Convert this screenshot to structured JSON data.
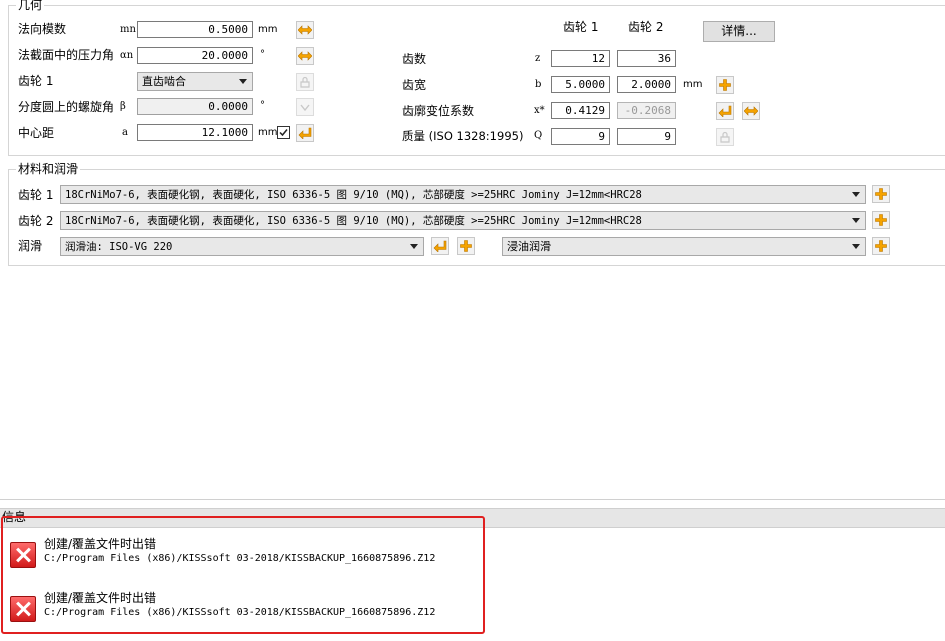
{
  "geometry": {
    "title": "几何",
    "normal_module": {
      "label": "法向模数",
      "symbol": "mn",
      "value": "0.5000",
      "unit": "mm"
    },
    "pressure_angle": {
      "label": "法截面中的压力角",
      "symbol": "αn",
      "value": "20.0000",
      "unit": "°"
    },
    "gear1": {
      "label": "齿轮 1",
      "type_value": "直齿啮合"
    },
    "helix_angle": {
      "label": "分度圆上的螺旋角",
      "symbol": "β",
      "value": "0.0000",
      "unit": "°"
    },
    "center_distance": {
      "label": "中心距",
      "symbol": "a",
      "value": "12.1000",
      "unit": "mm",
      "checkbox_checked": true
    },
    "col_gear1": "齿轮 1",
    "col_gear2": "齿轮 2",
    "details_button": "详情...",
    "teeth": {
      "label": "齿数",
      "symbol": "z",
      "gear1": "12",
      "gear2": "36"
    },
    "face_width": {
      "label": "齿宽",
      "symbol": "b",
      "gear1": "5.0000",
      "gear2": "2.0000",
      "unit": "mm"
    },
    "profile_shift": {
      "label": "齿廓变位系数",
      "symbol": "x*",
      "gear1": "0.4129",
      "gear2": "-0.2068"
    },
    "quality": {
      "label": "质量 (ISO 1328:1995)",
      "symbol": "Q",
      "gear1": "9",
      "gear2": "9"
    }
  },
  "materials": {
    "title": "材料和润滑",
    "gear1": {
      "label": "齿轮 1",
      "value": "18CrNiMo7-6, 表面硬化钢, 表面硬化, ISO 6336-5 图 9/10 (MQ), 芯部硬度 >=25HRC Jominy J=12mm<HRC28"
    },
    "gear2": {
      "label": "齿轮 2",
      "value": "18CrNiMo7-6, 表面硬化钢, 表面硬化, ISO 6336-5 图 9/10 (MQ), 芯部硬度 >=25HRC Jominy J=12mm<HRC28"
    },
    "lubrication": {
      "label": "润滑",
      "oil": "润滑油: ISO-VG 220",
      "method": "浸油润滑"
    }
  },
  "info": {
    "title": "信息",
    "messages": [
      {
        "title": "创建/覆盖文件时出错",
        "path": "C:/Program Files (x86)/KISSsoft 03-2018/KISSBACKUP_1660875896.Z12"
      },
      {
        "title": "创建/覆盖文件时出错",
        "path": "C:/Program Files (x86)/KISSsoft 03-2018/KISSBACKUP_1660875896.Z12"
      }
    ]
  },
  "colors": {
    "accent_orange": "#f5a300",
    "error_red": "#e03030",
    "highlight_border": "#e02020"
  },
  "icons": {
    "sync": "double-arrow-icon",
    "enter": "enter-arrow-icon",
    "plus": "plus-icon",
    "lock": "lock-icon",
    "error": "error-x-icon"
  }
}
